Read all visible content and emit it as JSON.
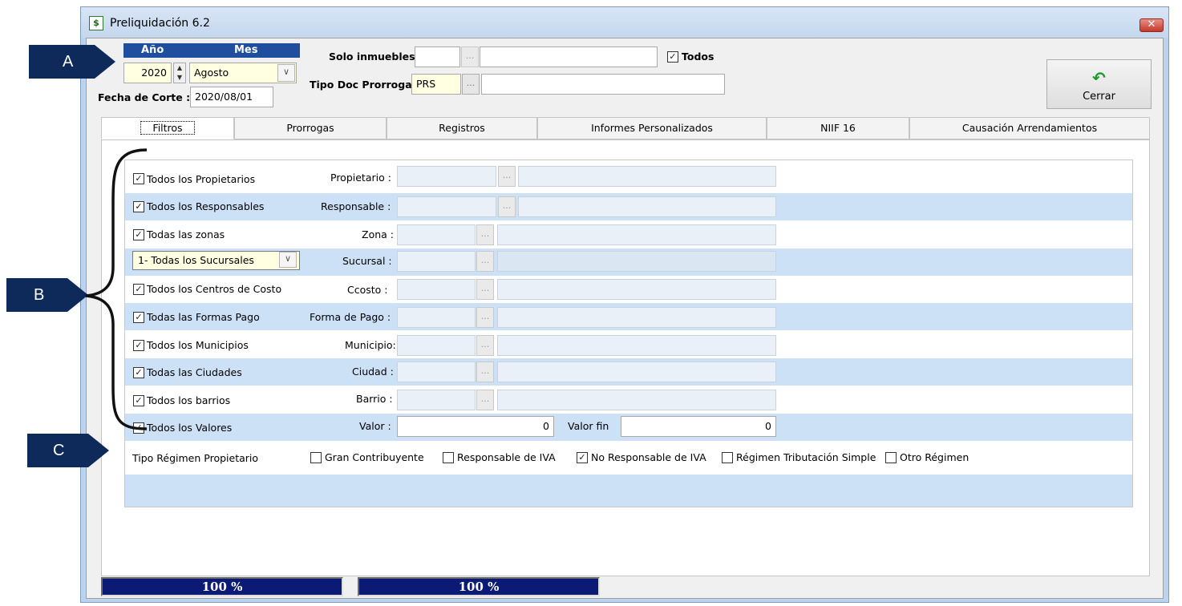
{
  "window": {
    "title": "Preliquidación 6.2",
    "close": "✕"
  },
  "header": {
    "year_label": "Año",
    "month_label": "Mes",
    "year_value": "2020",
    "month_value": "Agosto",
    "fecha_corte_label": "Fecha de Corte :",
    "fecha_corte_value": "2020/08/01",
    "solo_inmuebles_label": "Solo inmuebles :",
    "solo_inmuebles_code": "",
    "solo_inmuebles_desc": "",
    "todos_label": "Todos",
    "todos_checked": true,
    "tipo_doc_label": "Tipo Doc Prorroga :",
    "tipo_doc_code": "PRS",
    "tipo_doc_desc": "",
    "ellipsis": "...",
    "cerrar_label": "Cerrar"
  },
  "tabs": [
    "Filtros",
    "Prorrogas",
    "Registros",
    "Informes Personalizados",
    "NIIF 16",
    "Causación Arrendamientos"
  ],
  "filters": {
    "rows": [
      {
        "check_label": "Todos los Propietarios",
        "checked": true,
        "field_label": "Propietario :"
      },
      {
        "check_label": "Todos los Responsables",
        "checked": true,
        "field_label": "Responsable :"
      },
      {
        "check_label": "Todas las zonas",
        "checked": true,
        "field_label": "Zona :"
      },
      {
        "combo_value": "1- Todas los Sucursales",
        "field_label": "Sucursal :"
      },
      {
        "check_label": "Todos los Centros de Costo",
        "checked": true,
        "field_label": "Ccosto :"
      },
      {
        "check_label": "Todas las Formas Pago",
        "checked": true,
        "field_label": "Forma de Pago :"
      },
      {
        "check_label": "Todos los Municipios",
        "checked": true,
        "field_label": "Municipio:"
      },
      {
        "check_label": "Todas las Ciudades",
        "checked": true,
        "field_label": "Ciudad :"
      },
      {
        "check_label": "Todos los barrios",
        "checked": true,
        "field_label": "Barrio :"
      },
      {
        "check_label": "Todos los Valores",
        "checked": true,
        "field_label": "Valor :",
        "value": "0",
        "value_fin_label": "Valor fin",
        "value_fin": "0"
      }
    ],
    "regimen_label": "Tipo Régimen Propietario",
    "regimen_options": [
      {
        "label": "Gran Contribuyente",
        "checked": false
      },
      {
        "label": "Responsable de IVA",
        "checked": false
      },
      {
        "label": "No Responsable de IVA",
        "checked": true
      },
      {
        "label": "Régimen Tributación Simple",
        "checked": false
      },
      {
        "label": "Otro Régimen",
        "checked": false
      }
    ]
  },
  "progress": [
    {
      "label": "100 %",
      "value": 1.0
    },
    {
      "label": "100 %",
      "value": 1.0
    }
  ],
  "annotations": {
    "a": "A",
    "b": "B",
    "c": "C"
  },
  "colors": {
    "accent": "#1f4e9e",
    "row_alt": "#cce0f6",
    "badge": "#0e2a5a",
    "progress": "#0b1a74"
  }
}
